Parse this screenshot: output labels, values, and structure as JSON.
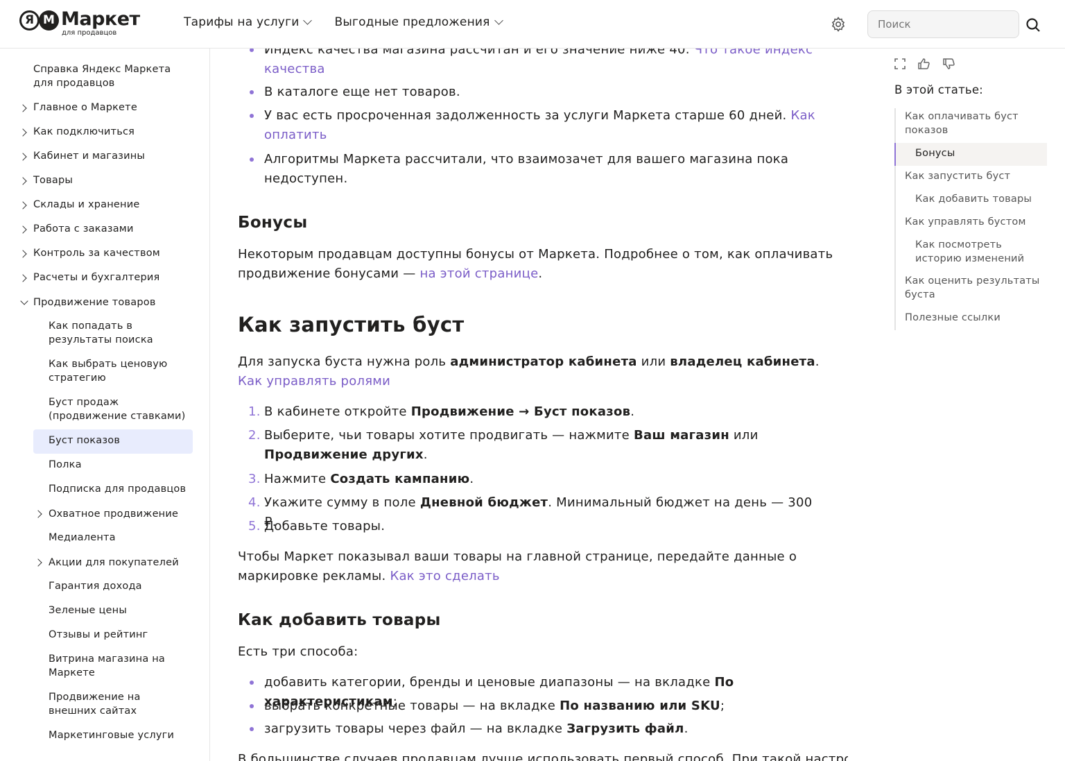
{
  "header": {
    "logo_word": "Маркет",
    "logo_sub": "для продавцов",
    "nav": [
      {
        "label": "Тарифы на услуги"
      },
      {
        "label": "Выгодные предложения"
      }
    ],
    "search_placeholder": "Поиск"
  },
  "sidebar": {
    "title": "Справка Яндекс Маркета для продавцов",
    "sections": [
      "Главное о Маркете",
      "Как подключиться",
      "Кабинет и магазины",
      "Товары",
      "Склады и хранение",
      "Работа с заказами",
      "Контроль за качеством",
      "Расчеты и бухгалтерия",
      "Продвижение товаров"
    ],
    "sub": [
      " Как попадать в результаты поиска",
      " Как выбрать ценовую стратегию",
      "Буст продаж (продвижение ставками)",
      "Буст показов",
      "Полка",
      "Подписка для продавцов",
      "Охватное продвижение",
      "Медиалента",
      "Акции для покупателей",
      "Гарантия дохода",
      "Зеленые цены",
      "Отзывы и рейтинг",
      "Витрина магазина на Маркете",
      "Продвижение на внешних сайтах",
      "Маркетинговые услуги"
    ]
  },
  "article": {
    "top_bullets": [
      {
        "text": "Индекс качества магазина рассчитан и его значение ниже 40. ",
        "link": "Что такое индекс качества"
      },
      {
        "text": "В каталоге еще нет товаров.",
        "link": ""
      },
      {
        "text": "У вас есть просроченная задолженность за услуги Маркета старше 60 дней. ",
        "link": "Как оплатить"
      },
      {
        "text": "Алгоритмы Маркета рассчитали, что взаимозачет для вашего магазина пока недоступен.",
        "link": ""
      }
    ],
    "bonus_heading": "Бонусы",
    "bonus_text": "Некоторым продавцам доступны бонусы от Маркета. Подробнее о том, как оплачивать продвижение бонусами — ",
    "bonus_link": "на этой странице",
    "launch_heading": "Как запустить буст",
    "launch_intro_1": "Для запуска буста нужна роль ",
    "launch_role_1": "администратор кабинета",
    "launch_or": " или ",
    "launch_role_2": "владелец кабинета",
    "launch_link": "Как управлять ролями",
    "steps": [
      {
        "n": "1.",
        "a": "В кабинете откройте ",
        "b": "Продвижение → Буст показов",
        "c": "."
      },
      {
        "n": "2.",
        "a": "Выберите, чьи товары хотите продвигать — нажмите ",
        "b": "Ваш магазин",
        "c": " или ",
        "d": "Продвижение других",
        "e": "."
      },
      {
        "n": "3.",
        "a": "Нажмите ",
        "b": "Создать кампанию",
        "c": "."
      },
      {
        "n": "4.",
        "a": "Укажите сумму в поле ",
        "b": "Дневной бюджет",
        "c": ". Минимальный бюджет на день — 300 ₽."
      },
      {
        "n": "5.",
        "a": "Добавьте товары.",
        "b": "",
        "c": ""
      }
    ],
    "marking_text": "Чтобы Маркет показывал ваши товары на главной странице, передайте данные о маркировке рекламы. ",
    "marking_link": "Как это сделать",
    "add_heading": "Как добавить товары",
    "add_intro": "Есть три способа:",
    "methods": [
      {
        "a": "добавить категории, бренды и ценовые диапазоны — на вкладке ",
        "b": "По характеристикам",
        "c": ";"
      },
      {
        "a": "выбрать конкретные товары — на вкладке ",
        "b": "По названию или SKU",
        "c": ";"
      },
      {
        "a": "загрузить товары через файл — на вкладке ",
        "b": "Загрузить файл",
        "c": "."
      }
    ],
    "bottom_cut": "В большинстве случаев продавцам лучше использовать первый способ. При такой настройке"
  },
  "toc": {
    "title": "В этой статье:",
    "items": [
      "Как оплачивать буст показов",
      "Бонусы",
      "Как запустить буст",
      "Как добавить товары",
      "Как управлять бустом",
      "Как посмотреть историю изменений",
      "Как оценить результаты буста",
      "Полезные ссылки"
    ]
  },
  "colors": {
    "accent": "#7a5cc7",
    "active_bg": "#e8ecfd",
    "text": "#21201f"
  }
}
